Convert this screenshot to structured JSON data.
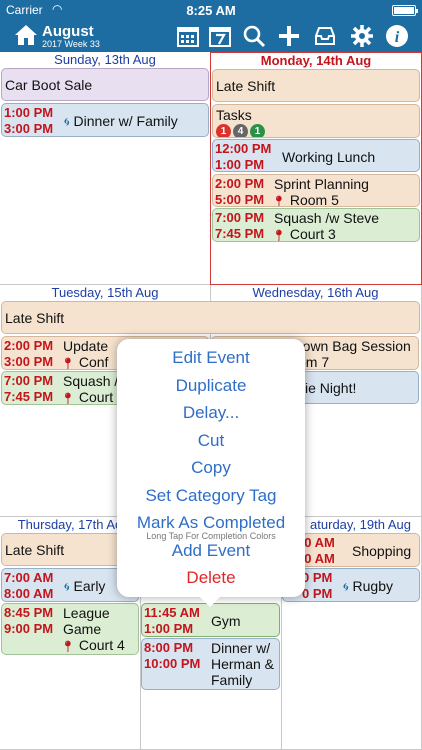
{
  "status": {
    "carrier": "Carrier",
    "time": "8:25 AM"
  },
  "nav": {
    "month": "August",
    "week": "2017 Week 33"
  },
  "days": {
    "sun": {
      "header": "Sunday, 13th Aug",
      "events": [
        {
          "title": "Car Boot Sale"
        },
        {
          "start": "1:00 PM",
          "end": "3:00 PM",
          "title": "Dinner w/ Family"
        }
      ]
    },
    "mon": {
      "header": "Monday, 14th Aug",
      "events": [
        {
          "title": "Late Shift"
        },
        {
          "title": "Tasks",
          "badges": [
            "1",
            "4",
            "1"
          ]
        },
        {
          "start": "12:00 PM",
          "end": "1:00 PM",
          "title": "Working Lunch"
        },
        {
          "start": "2:00 PM",
          "end": "5:00 PM",
          "title": "Sprint Planning",
          "location": "Room 5"
        },
        {
          "start": "7:00 PM",
          "end": "7:45 PM",
          "title": "Squash /w Steve",
          "location": "Court 3"
        }
      ]
    },
    "tue": {
      "header": "Tuesday, 15th Aug",
      "events": [
        {
          "title": "Late Shift"
        },
        {
          "start": "2:00 PM",
          "end": "3:00 PM",
          "title": "Update",
          "location": "Conf"
        },
        {
          "start": "7:00 PM",
          "end": "7:45 PM",
          "title": "Squash /",
          "location": "Court 3"
        }
      ]
    },
    "wed": {
      "header": "Wednesday, 16th Aug",
      "events": [
        {
          "title": "rown Bag Session",
          "location": "om 7"
        },
        {
          "title": "vie Night!"
        }
      ]
    },
    "thu": {
      "header": "Thursday, 17th Ao",
      "events": [
        {
          "title": "Late Shift"
        },
        {
          "start": "7:00 AM",
          "end": "8:00 AM",
          "title": "Early"
        },
        {
          "start": "8:45 PM",
          "end": "9:00 PM",
          "title": "League",
          "title2": "Game",
          "location": "Court 4"
        }
      ]
    },
    "fri": {
      "events": [
        {
          "start": "11:45 AM",
          "end": "1:00 PM",
          "title": "Gym"
        },
        {
          "start": "8:00 PM",
          "end": "10:00 PM",
          "title": "Dinner w/",
          "title2": "Herman &",
          "title3": "Family"
        }
      ]
    },
    "sat": {
      "header": "aturday, 19th Aug",
      "events": [
        {
          "start": "00 AM",
          "end": "00 AM",
          "title": "Shopping"
        },
        {
          "start": "0 PM",
          "end": "0 PM",
          "title": "Rugby"
        }
      ]
    }
  },
  "menu": {
    "items": [
      "Edit Event",
      "Duplicate",
      "Delay...",
      "Cut",
      "Copy",
      "Set Category Tag",
      "Mark As Completed"
    ],
    "hint": "Long Tap For Completion Colors",
    "add": "Add Event",
    "delete": "Delete"
  },
  "colors": {
    "nav": "#1d6da3",
    "time_red": "#c4141c",
    "menu_blue": "#2f6ec7",
    "delete_red": "#e02626"
  }
}
